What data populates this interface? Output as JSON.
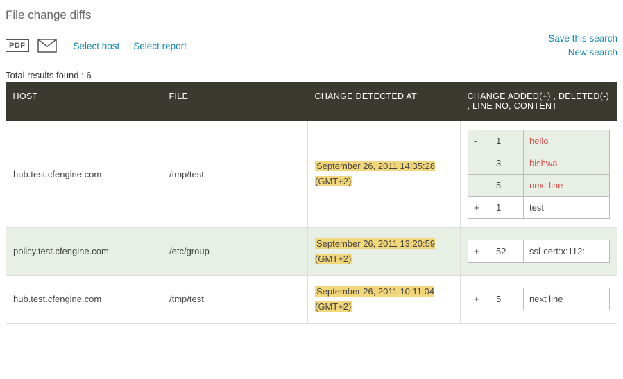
{
  "title": "File change diffs",
  "toolbar": {
    "pdf_label": "PDF",
    "select_host": "Select host",
    "select_report": "Select report",
    "save_search": "Save this search",
    "new_search": "New search"
  },
  "total_label": "Total results found : 6",
  "columns": {
    "host": "HOST",
    "file": "FILE",
    "detected": "CHANGE DETECTED AT",
    "diff": "CHANGE ADDED(+) , DELETED(-) , LINE NO, CONTENT"
  },
  "rows": [
    {
      "host": "hub.test.cfengine.com",
      "file": "/tmp/test",
      "detected": "September 26, 2011 14:35:28 (GMT+2)",
      "changes": [
        {
          "sign": "-",
          "line": "1",
          "content": "hello"
        },
        {
          "sign": "-",
          "line": "3",
          "content": "bishwa"
        },
        {
          "sign": "-",
          "line": "5",
          "content": "next line"
        },
        {
          "sign": "+",
          "line": "1",
          "content": "test"
        }
      ]
    },
    {
      "host": "policy.test.cfengine.com",
      "file": "/etc/group",
      "detected": "September 26, 2011 13:20:59 (GMT+2)",
      "changes": [
        {
          "sign": "+",
          "line": "52",
          "content": "ssl-cert:x:112:"
        }
      ]
    },
    {
      "host": "hub.test.cfengine.com",
      "file": "/tmp/test",
      "detected": "September 26, 2011 10:11:04 (GMT+2)",
      "changes": [
        {
          "sign": "+",
          "line": "5",
          "content": "next line"
        }
      ]
    }
  ]
}
